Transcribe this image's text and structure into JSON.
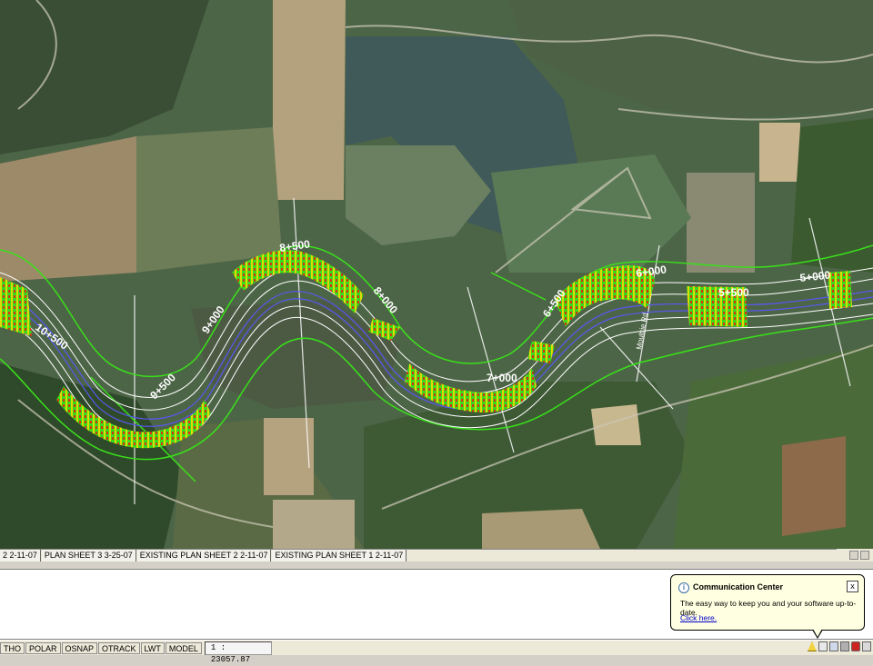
{
  "map": {
    "stations": [
      "10+500",
      "9+500",
      "9+000",
      "8+500",
      "8+000",
      "7+000",
      "6+500",
      "6+000",
      "5+500",
      "5+000"
    ],
    "side_label": "Moultrie Rd"
  },
  "layout_tabs": [
    "2  2-11-07",
    "PLAN SHEET 3  3-25-07",
    "EXISTING PLAN SHEET 2  2-11-07",
    "EXISTING PLAN SHEET 1  2-11-07"
  ],
  "status_buttons": [
    "THO",
    "POLAR",
    "OSNAP",
    "OTRACK",
    "LWT",
    "MODEL"
  ],
  "scale": "1 : 23057.87",
  "balloon": {
    "title": "Communication Center",
    "message": "The easy way to keep you and your software up-to-date.",
    "link": "Click here.",
    "close": "x"
  },
  "colors": {
    "alignment_green": "#39e01a",
    "offset_lines": "#ffffff",
    "ribs_yellow": "#e8e000",
    "ribs_red": "#e03010"
  }
}
